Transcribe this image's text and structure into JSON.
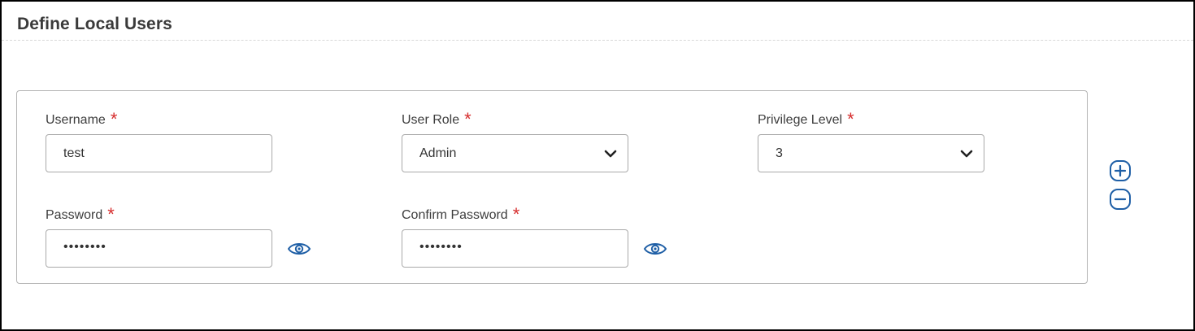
{
  "panel": {
    "title": "Define Local Users"
  },
  "form": {
    "required_marker": "*",
    "username": {
      "label": "Username",
      "value": "test"
    },
    "user_role": {
      "label": "User Role",
      "selected": "Admin"
    },
    "privilege_level": {
      "label": "Privilege Level",
      "selected": "3"
    },
    "password": {
      "label": "Password",
      "masked_value": "••••••••"
    },
    "confirm_password": {
      "label": "Confirm Password",
      "masked_value": "••••••••"
    }
  },
  "icons": {
    "accent_color": "#1f5fa6",
    "show_password": "eye-icon",
    "add_row": "plus-circle-icon",
    "remove_row": "minus-circle-icon",
    "dropdown": "chevron-down-icon"
  },
  "colors": {
    "required": "#d62d2d",
    "border": "#a9a9a9"
  }
}
